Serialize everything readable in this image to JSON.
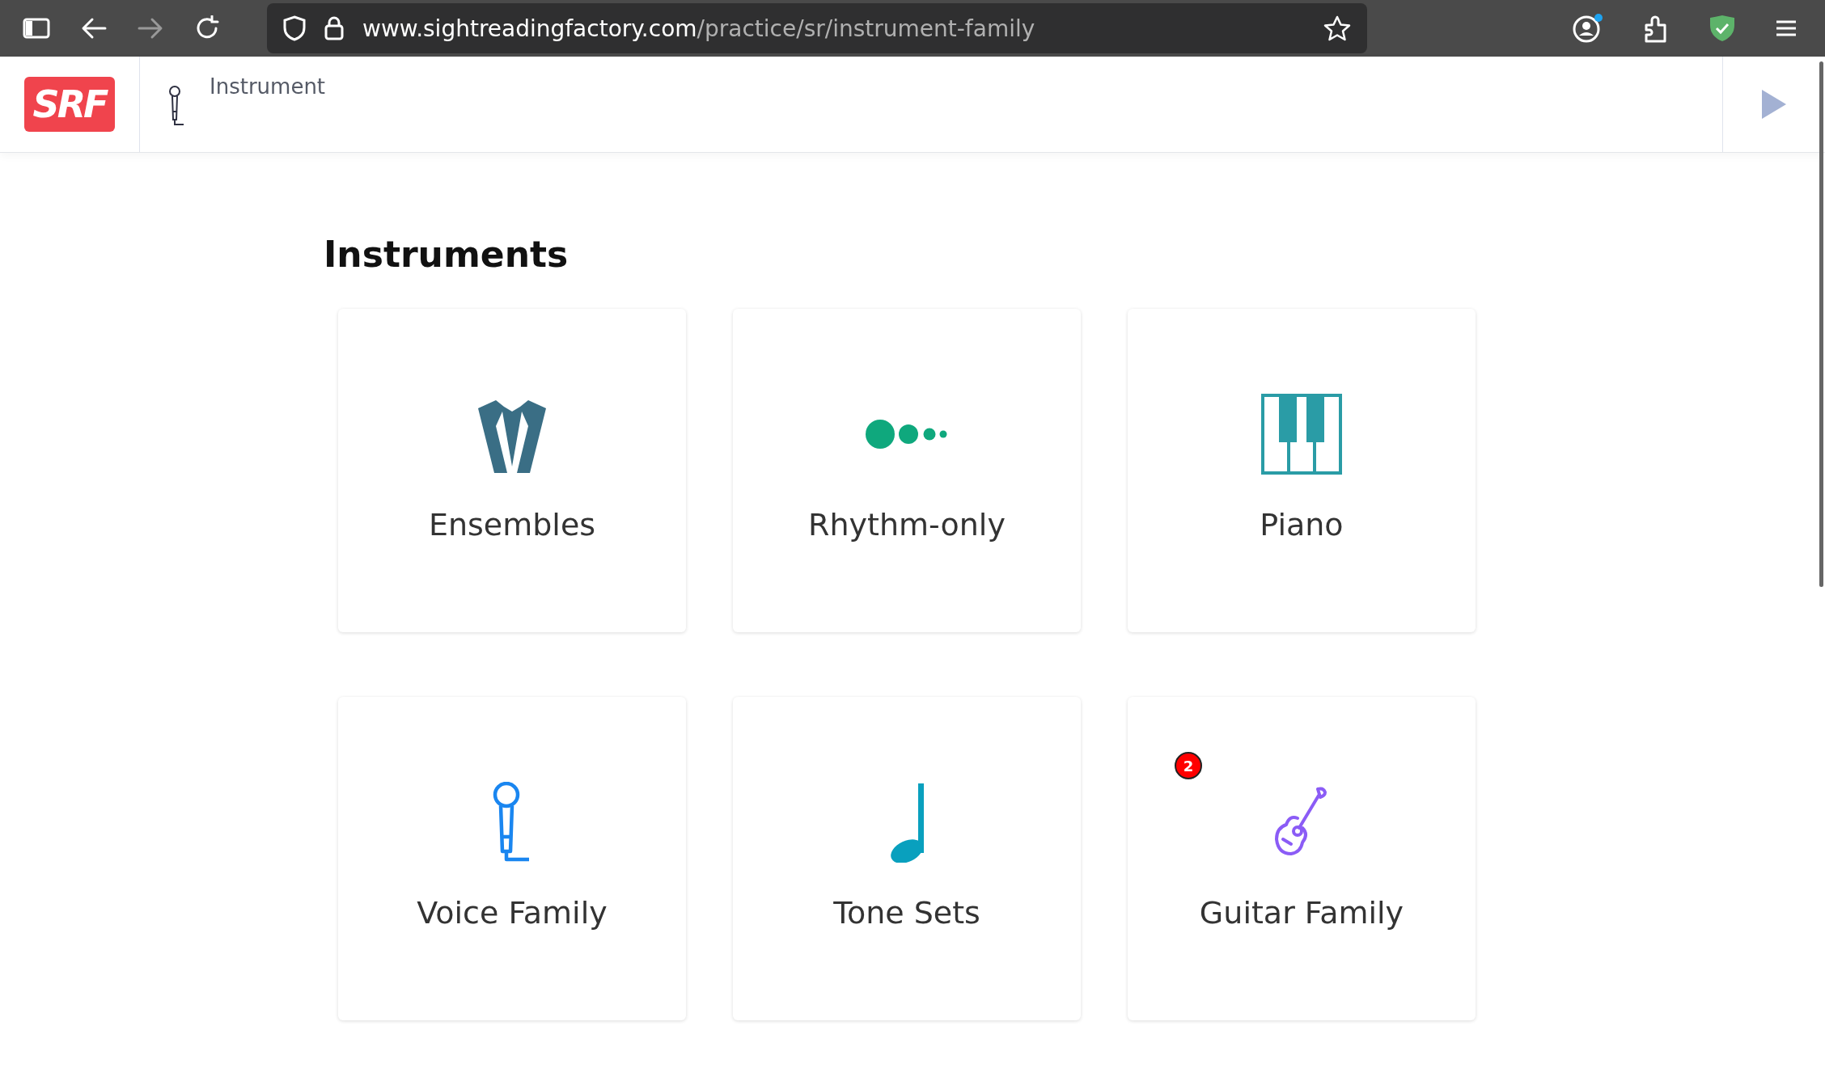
{
  "browser": {
    "url_host": "www.sightreadingfactory.com",
    "url_path": "/practice/sr/instrument-family"
  },
  "header": {
    "logo": "SRF",
    "breadcrumb": "Instrument"
  },
  "heading": "Instruments",
  "cards": [
    {
      "kind": "tuxedo",
      "label": "Ensembles"
    },
    {
      "kind": "dots",
      "label": "Rhythm-only"
    },
    {
      "kind": "piano",
      "label": "Piano"
    },
    {
      "kind": "microphone",
      "label": "Voice Family"
    },
    {
      "kind": "note",
      "label": "Tone Sets"
    },
    {
      "kind": "guitar",
      "label": "Guitar Family",
      "badge": "2"
    }
  ]
}
